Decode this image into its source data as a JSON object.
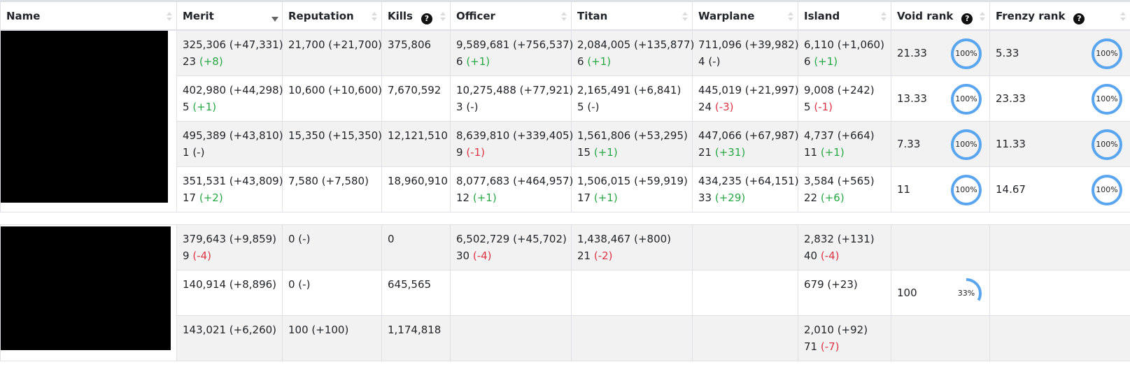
{
  "headers": [
    {
      "label": "Name",
      "sort": "none",
      "help": false
    },
    {
      "label": "Merit",
      "sort": "desc",
      "help": false
    },
    {
      "label": "Reputation",
      "sort": "none",
      "help": false
    },
    {
      "label": "Kills",
      "sort": "none",
      "help": true
    },
    {
      "label": "Officer",
      "sort": "none",
      "help": false
    },
    {
      "label": "Titan",
      "sort": "none",
      "help": false
    },
    {
      "label": "Warplane",
      "sort": "none",
      "help": false
    },
    {
      "label": "Island",
      "sort": "none",
      "help": false
    },
    {
      "label": "Void rank",
      "sort": "none",
      "help": true
    },
    {
      "label": "Frenzy rank",
      "sort": "none",
      "help": true
    }
  ],
  "help_glyph": "?",
  "colors": {
    "positive": "#28a745",
    "negative": "#dc3545",
    "ring": "#5aa5f0"
  },
  "groups": [
    {
      "rows": [
        {
          "merit": {
            "value": "325,306 (+47,331)",
            "rank": "23",
            "delta": "(+8)",
            "dir": "pos"
          },
          "reputation": "21,700 (+21,700)",
          "kills": "375,806",
          "officer": {
            "value": "9,589,681 (+756,537)",
            "rank": "6",
            "delta": "(+1)",
            "dir": "pos"
          },
          "titan": {
            "value": "2,084,005 (+135,877)",
            "rank": "6",
            "delta": "(+1)",
            "dir": "pos"
          },
          "warplane": {
            "value": "711,096 (+39,982)",
            "rank": "4",
            "delta": "(-)",
            "dir": "none"
          },
          "island": {
            "value": "6,110 (+1,060)",
            "rank": "6",
            "delta": "(+1)",
            "dir": "pos"
          },
          "void": {
            "value": "21.33",
            "pct_label": "100%",
            "progress": 1.0
          },
          "frenzy": {
            "value": "5.33",
            "pct_label": "100%",
            "progress": 1.0
          }
        },
        {
          "merit": {
            "value": "402,980 (+44,298)",
            "rank": "5",
            "delta": "(+1)",
            "dir": "pos"
          },
          "reputation": "10,600 (+10,600)",
          "kills": "7,670,592",
          "officer": {
            "value": "10,275,488 (+77,921)",
            "rank": "3",
            "delta": "(-)",
            "dir": "none"
          },
          "titan": {
            "value": "2,165,491 (+6,841)",
            "rank": "5",
            "delta": "(-)",
            "dir": "none"
          },
          "warplane": {
            "value": "445,019 (+21,997)",
            "rank": "24",
            "delta": "(-3)",
            "dir": "neg"
          },
          "island": {
            "value": "9,008 (+242)",
            "rank": "5",
            "delta": "(-1)",
            "dir": "neg"
          },
          "void": {
            "value": "13.33",
            "pct_label": "100%",
            "progress": 1.0
          },
          "frenzy": {
            "value": "23.33",
            "pct_label": "100%",
            "progress": 1.0
          }
        },
        {
          "merit": {
            "value": "495,389 (+43,810)",
            "rank": "1",
            "delta": "(-)",
            "dir": "none"
          },
          "reputation": "15,350 (+15,350)",
          "kills": "12,121,510",
          "officer": {
            "value": "8,639,810 (+339,405)",
            "rank": "9",
            "delta": "(-1)",
            "dir": "neg"
          },
          "titan": {
            "value": "1,561,806 (+53,295)",
            "rank": "15",
            "delta": "(+1)",
            "dir": "pos"
          },
          "warplane": {
            "value": "447,066 (+67,987)",
            "rank": "21",
            "delta": "(+31)",
            "dir": "pos"
          },
          "island": {
            "value": "4,737 (+664)",
            "rank": "11",
            "delta": "(+1)",
            "dir": "pos"
          },
          "void": {
            "value": "7.33",
            "pct_label": "100%",
            "progress": 1.0
          },
          "frenzy": {
            "value": "11.33",
            "pct_label": "100%",
            "progress": 1.0
          }
        },
        {
          "merit": {
            "value": "351,531 (+43,809)",
            "rank": "17",
            "delta": "(+2)",
            "dir": "pos"
          },
          "reputation": "7,580 (+7,580)",
          "kills": "18,960,910",
          "officer": {
            "value": "8,077,683 (+464,957)",
            "rank": "12",
            "delta": "(+1)",
            "dir": "pos"
          },
          "titan": {
            "value": "1,506,015 (+59,919)",
            "rank": "17",
            "delta": "(+1)",
            "dir": "pos"
          },
          "warplane": {
            "value": "434,235 (+64,151)",
            "rank": "33",
            "delta": "(+29)",
            "dir": "pos"
          },
          "island": {
            "value": "3,584 (+565)",
            "rank": "22",
            "delta": "(+6)",
            "dir": "pos"
          },
          "void": {
            "value": "11",
            "pct_label": "100%",
            "progress": 1.0
          },
          "frenzy": {
            "value": "14.67",
            "pct_label": "100%",
            "progress": 1.0
          }
        }
      ]
    },
    {
      "rows": [
        {
          "merit": {
            "value": "379,643 (+9,859)",
            "rank": "9",
            "delta": "(-4)",
            "dir": "neg"
          },
          "reputation": "0 (-)",
          "kills": "0",
          "officer": {
            "value": "6,502,729 (+45,702)",
            "rank": "30",
            "delta": "(-4)",
            "dir": "neg"
          },
          "titan": {
            "value": "1,438,467 (+800)",
            "rank": "21",
            "delta": "(-2)",
            "dir": "neg"
          },
          "warplane": null,
          "island": {
            "value": "2,832 (+131)",
            "rank": "40",
            "delta": "(-4)",
            "dir": "neg"
          },
          "void": null,
          "frenzy": null
        },
        {
          "merit": {
            "value": "140,914 (+8,896)",
            "rank": "",
            "delta": "",
            "dir": "none"
          },
          "reputation": "0 (-)",
          "kills": "645,565",
          "officer": null,
          "titan": null,
          "warplane": null,
          "island": {
            "value": "679 (+23)",
            "rank": "",
            "delta": "",
            "dir": "none"
          },
          "void": {
            "value": "100",
            "pct_label": "33%",
            "progress": 0.33
          },
          "frenzy": null
        },
        {
          "merit": {
            "value": "143,021 (+6,260)",
            "rank": "",
            "delta": "",
            "dir": "none"
          },
          "reputation": "100 (+100)",
          "kills": "1,174,818",
          "officer": null,
          "titan": null,
          "warplane": null,
          "island": {
            "value": "2,010 (+92)",
            "rank": "71",
            "delta": "(-7)",
            "dir": "neg"
          },
          "void": null,
          "frenzy": null
        }
      ]
    }
  ]
}
